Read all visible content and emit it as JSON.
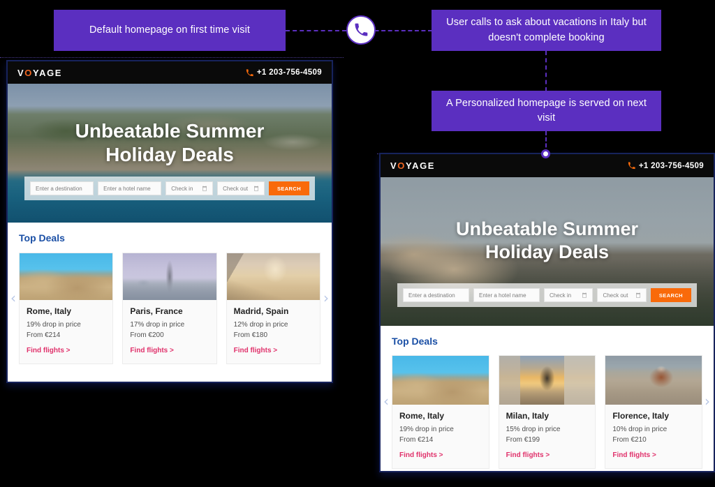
{
  "diagram": {
    "callouts": {
      "default_visit": "Default homepage on first time visit",
      "user_call": "User calls to ask about vacations in Italy but doesn't complete booking",
      "personalized": "A Personalized homepage is served on next visit"
    },
    "icons": {
      "phone_node": "phone-icon",
      "junction": "dot-node"
    },
    "colors": {
      "purple": "#5b2fc0",
      "background": "#000000",
      "browser_border": "#17235c",
      "accent_orange": "#f96a0a",
      "link_pink": "#e0316b",
      "heading_blue": "#1a4fa5"
    }
  },
  "browsers": [
    {
      "id": "default",
      "header": {
        "logo_before": "V",
        "logo_o": "O",
        "logo_after": "YAGE",
        "phone": "+1 203-756-4509",
        "phone_icon": "phone-icon"
      },
      "hero": {
        "title_line1": "Unbeatable Summer",
        "title_line2": "Holiday Deals",
        "image": "mallorca-coastline"
      },
      "search": {
        "destination_placeholder": "Enter a destination",
        "hotel_placeholder": "Enter a hotel name",
        "checkin_placeholder": "Check in",
        "checkout_placeholder": "Check out",
        "button_label": "SEARCH",
        "calendar_icon": "calendar-icon"
      },
      "deals": {
        "title": "Top Deals",
        "prev_arrow": "‹",
        "next_arrow": "›",
        "cards": [
          {
            "city": "Rome, Italy",
            "drop": "19% drop in price",
            "from": "From €214",
            "link": "Find flights >",
            "image": "colosseum"
          },
          {
            "city": "Paris, France",
            "drop": "17% drop in price",
            "from": "From €200",
            "link": "Find flights >",
            "image": "eiffel-tower"
          },
          {
            "city": "Madrid, Spain",
            "drop": "12% drop in price",
            "from": "From €180",
            "link": "Find flights >",
            "image": "madrid-street"
          }
        ]
      }
    },
    {
      "id": "personal",
      "header": {
        "logo_before": "V",
        "logo_o": "O",
        "logo_after": "YAGE",
        "phone": "+1 203-756-4509",
        "phone_icon": "phone-icon"
      },
      "hero": {
        "title_line1": "Unbeatable Summer",
        "title_line2": "Holiday Deals",
        "image": "colosseum"
      },
      "search": {
        "destination_placeholder": "Enter a destination",
        "hotel_placeholder": "Enter a hotel name",
        "checkin_placeholder": "Check in",
        "checkout_placeholder": "Check out",
        "button_label": "SEARCH",
        "calendar_icon": "calendar-icon"
      },
      "deals": {
        "title": "Top Deals",
        "prev_arrow": "‹",
        "next_arrow": "›",
        "cards": [
          {
            "city": "Rome, Italy",
            "drop": "19% drop in price",
            "from": "From €214",
            "link": "Find flights >",
            "image": "colosseum"
          },
          {
            "city": "Milan, Italy",
            "drop": "15% drop in price",
            "from": "From €199",
            "link": "Find flights >",
            "image": "milan-duomo"
          },
          {
            "city": "Florence, Italy",
            "drop": "10% drop in price",
            "from": "From €210",
            "link": "Find flights >",
            "image": "florence-duomo"
          }
        ]
      }
    }
  ]
}
